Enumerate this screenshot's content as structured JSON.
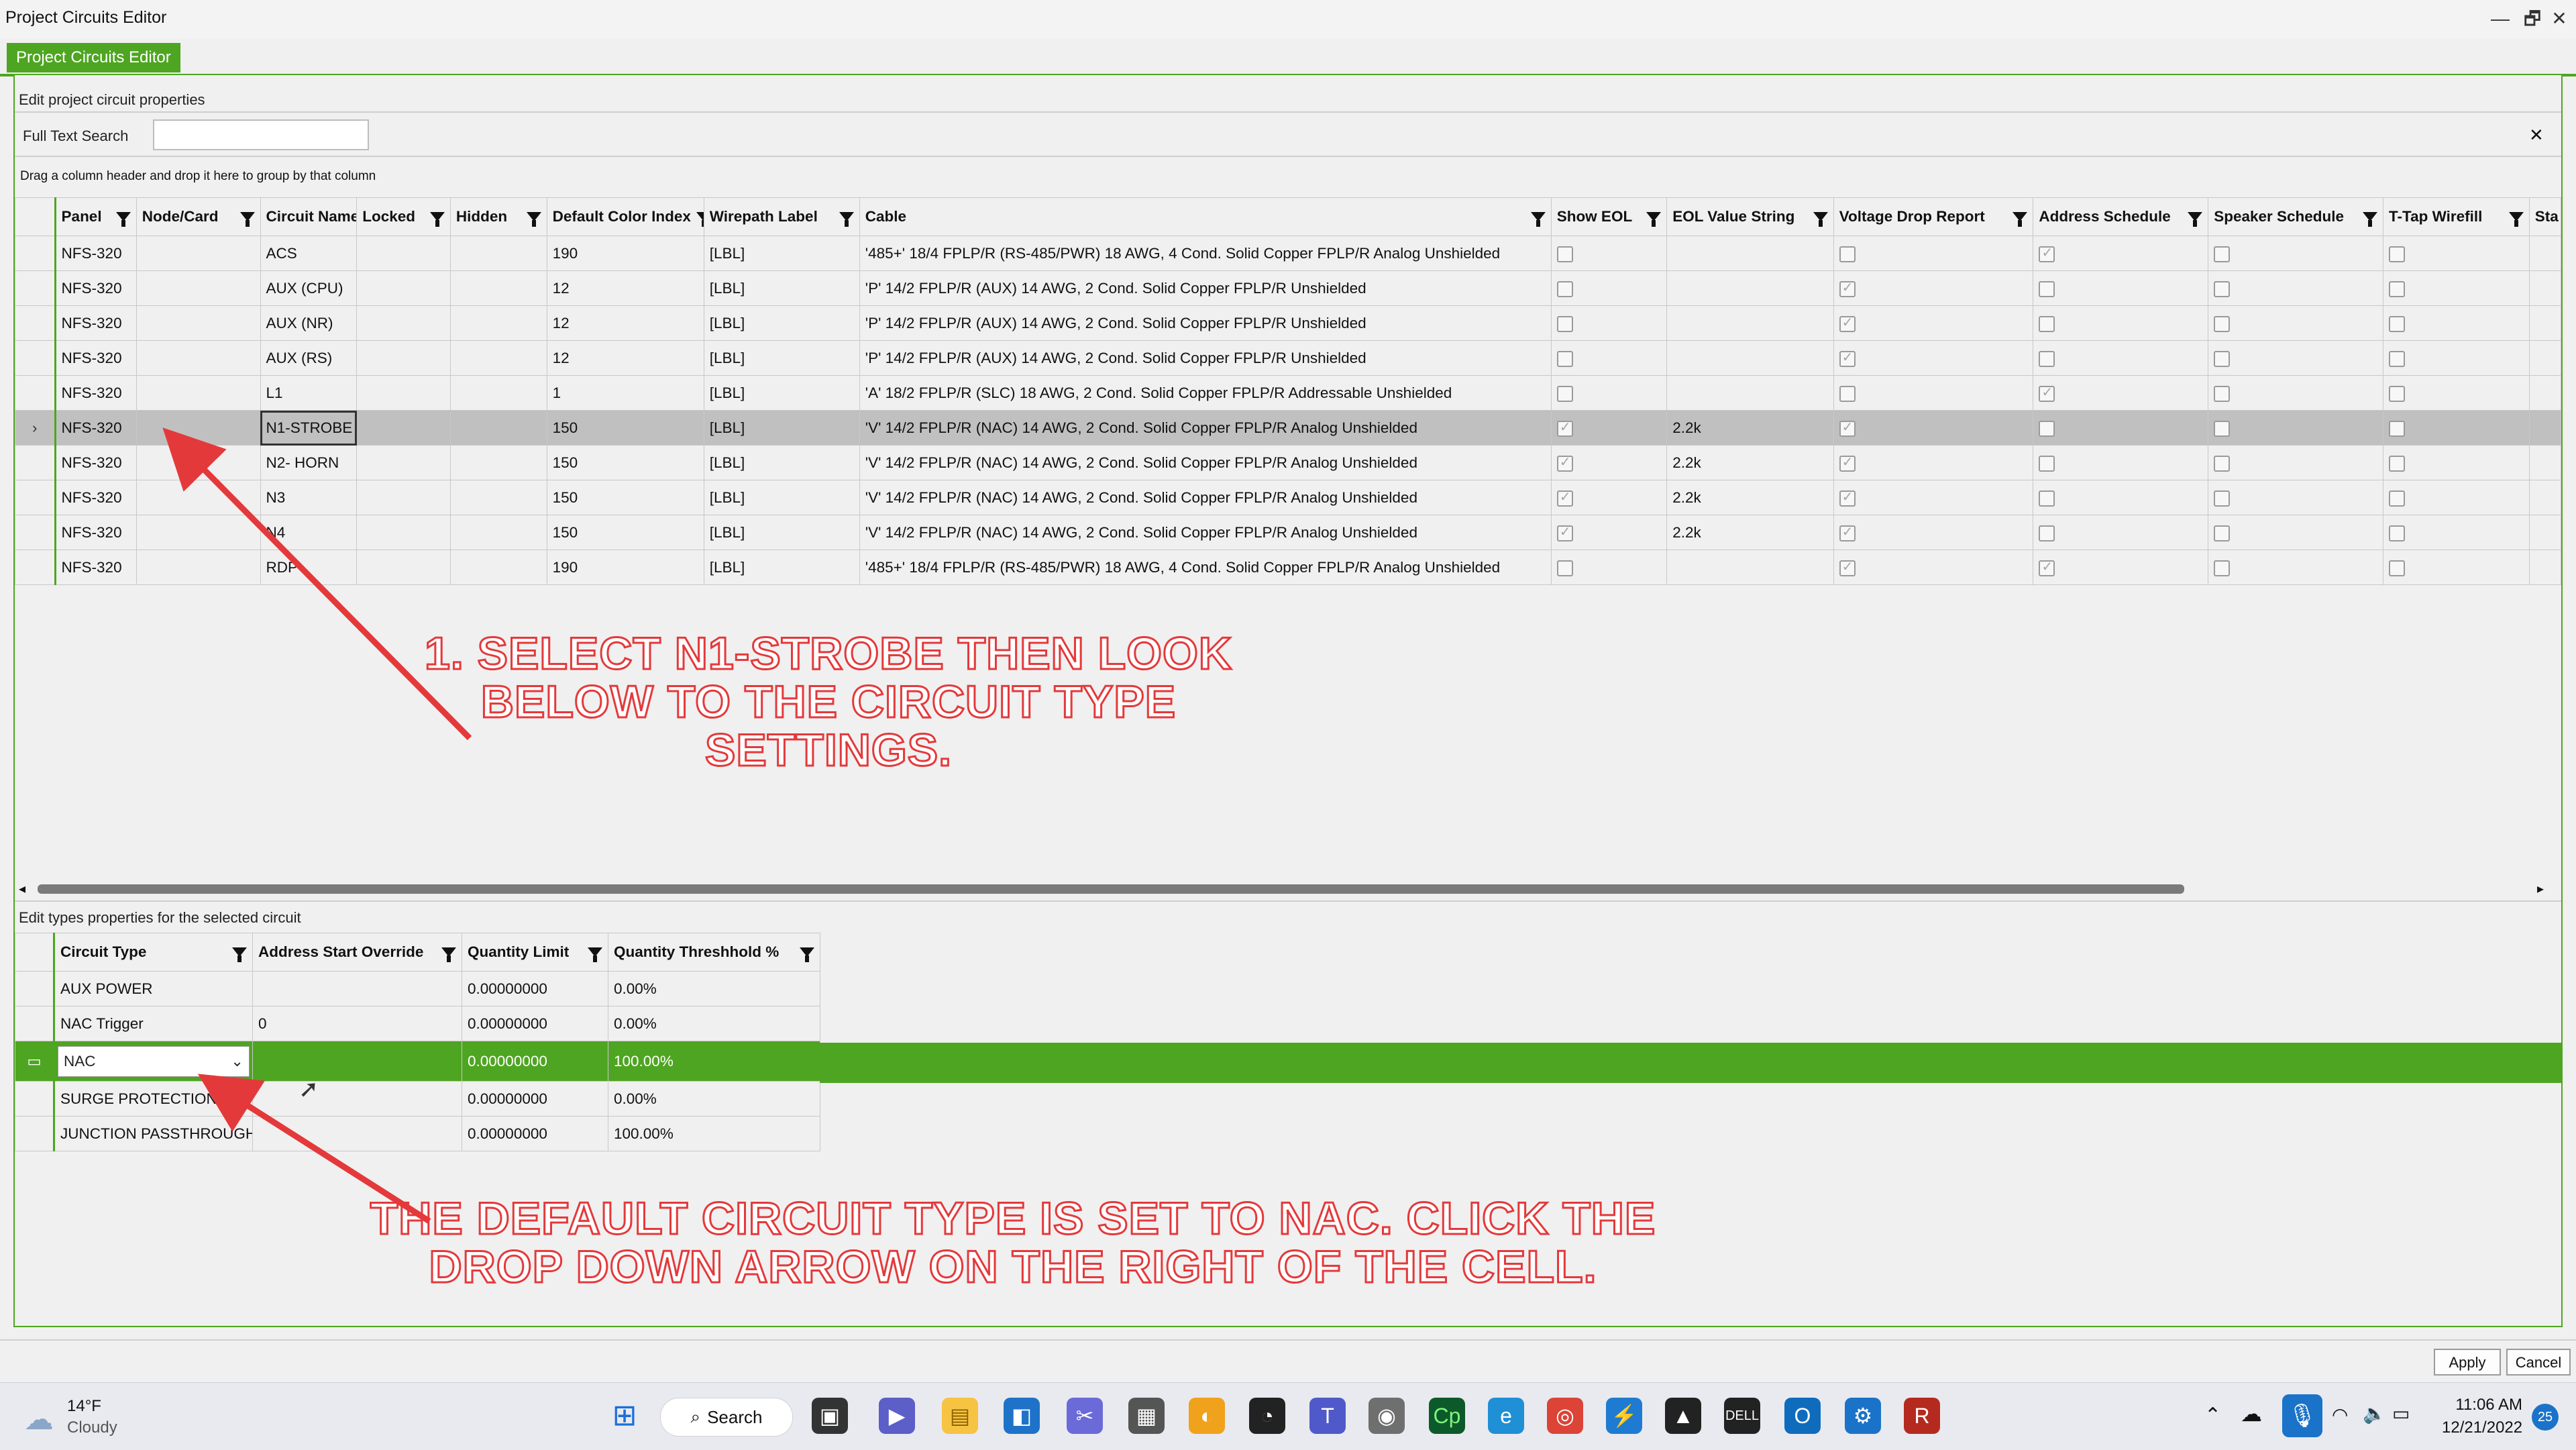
{
  "window": {
    "title": "Project Circuits Editor",
    "minimize": "—",
    "restore": "🗗",
    "close": "✕"
  },
  "tab": {
    "label": "Project Circuits Editor"
  },
  "circuits_section": {
    "title": "Edit project circuit properties",
    "search_label": "Full Text Search",
    "search_value": "",
    "clear": "✕",
    "group_hint": "Drag a column header and drop it here to group by that column",
    "columns": [
      "Panel",
      "Node/Card",
      "Circuit Name",
      "Locked",
      "Hidden",
      "Default Color Index",
      "Wirepath Label",
      "Cable",
      "Show EOL",
      "EOL Value String",
      "Voltage Drop Report",
      "Address Schedule",
      "Speaker Schedule",
      "T-Tap Wirefill",
      "Sta"
    ],
    "rows": [
      {
        "panel": "NFS-320",
        "node": "",
        "name": "ACS",
        "color": "190",
        "wirepath": "[LBL]",
        "cable": "'485+' 18/4 FPLP/R (RS-485/PWR) 18 AWG, 4 Cond. Solid Copper FPLP/R Analog Unshielded",
        "show_eol": false,
        "eol": "",
        "vdrop": false,
        "addr": true,
        "spk": false,
        "ttap": false
      },
      {
        "panel": "NFS-320",
        "node": "",
        "name": "AUX (CPU)",
        "color": "12",
        "wirepath": "[LBL]",
        "cable": "'P' 14/2 FPLP/R (AUX) 14 AWG, 2 Cond. Solid Copper FPLP/R  Unshielded",
        "show_eol": false,
        "eol": "",
        "vdrop": true,
        "addr": false,
        "spk": false,
        "ttap": false
      },
      {
        "panel": "NFS-320",
        "node": "",
        "name": "AUX (NR)",
        "color": "12",
        "wirepath": "[LBL]",
        "cable": "'P' 14/2 FPLP/R (AUX) 14 AWG, 2 Cond. Solid Copper FPLP/R  Unshielded",
        "show_eol": false,
        "eol": "",
        "vdrop": true,
        "addr": false,
        "spk": false,
        "ttap": false
      },
      {
        "panel": "NFS-320",
        "node": "",
        "name": "AUX (RS)",
        "color": "12",
        "wirepath": "[LBL]",
        "cable": "'P' 14/2 FPLP/R (AUX) 14 AWG, 2 Cond. Solid Copper FPLP/R  Unshielded",
        "show_eol": false,
        "eol": "",
        "vdrop": true,
        "addr": false,
        "spk": false,
        "ttap": false
      },
      {
        "panel": "NFS-320",
        "node": "",
        "name": "L1",
        "color": "1",
        "wirepath": "[LBL]",
        "cable": "'A' 18/2 FPLP/R (SLC) 18 AWG, 2 Cond. Solid Copper FPLP/R Addressable Unshielded",
        "show_eol": false,
        "eol": "",
        "vdrop": false,
        "addr": true,
        "spk": false,
        "ttap": false
      },
      {
        "panel": "NFS-320",
        "node": "",
        "name": "N1-STROBE",
        "color": "150",
        "wirepath": "[LBL]",
        "cable": "'V' 14/2 FPLP/R (NAC) 14 AWG, 2 Cond. Solid Copper FPLP/R Analog Unshielded",
        "show_eol": true,
        "eol": "2.2k",
        "vdrop": true,
        "addr": false,
        "spk": false,
        "ttap": false
      },
      {
        "panel": "NFS-320",
        "node": "",
        "name": "N2- HORN",
        "color": "150",
        "wirepath": "[LBL]",
        "cable": "'V' 14/2 FPLP/R (NAC) 14 AWG, 2 Cond. Solid Copper FPLP/R Analog Unshielded",
        "show_eol": true,
        "eol": "2.2k",
        "vdrop": true,
        "addr": false,
        "spk": false,
        "ttap": false
      },
      {
        "panel": "NFS-320",
        "node": "",
        "name": "N3",
        "color": "150",
        "wirepath": "[LBL]",
        "cable": "'V' 14/2 FPLP/R (NAC) 14 AWG, 2 Cond. Solid Copper FPLP/R Analog Unshielded",
        "show_eol": true,
        "eol": "2.2k",
        "vdrop": true,
        "addr": false,
        "spk": false,
        "ttap": false
      },
      {
        "panel": "NFS-320",
        "node": "",
        "name": "N4",
        "color": "150",
        "wirepath": "[LBL]",
        "cable": "'V' 14/2 FPLP/R (NAC) 14 AWG, 2 Cond. Solid Copper FPLP/R Analog Unshielded",
        "show_eol": true,
        "eol": "2.2k",
        "vdrop": true,
        "addr": false,
        "spk": false,
        "ttap": false
      },
      {
        "panel": "NFS-320",
        "node": "",
        "name": "RDP",
        "color": "190",
        "wirepath": "[LBL]",
        "cable": "'485+' 18/4 FPLP/R (RS-485/PWR) 18 AWG, 4 Cond. Solid Copper FPLP/R Analog Unshielded",
        "show_eol": false,
        "eol": "",
        "vdrop": true,
        "addr": true,
        "spk": false,
        "ttap": false
      }
    ],
    "selected_row_marker": "›"
  },
  "annotation1": {
    "lines": [
      "1. SELECT N1-STROBE THEN LOOK",
      "BELOW TO THE CIRCUIT TYPE",
      "SETTINGS."
    ]
  },
  "types_section": {
    "title": "Edit types properties for the selected circuit",
    "columns": [
      "Circuit Type",
      "Address Start Override",
      "Quantity Limit",
      "Quantity Threshhold %"
    ],
    "rows": [
      {
        "type": "AUX POWER",
        "start": "",
        "limit": "0.00000000",
        "threshold": "0.00%"
      },
      {
        "type": "NAC Trigger",
        "start": "0",
        "limit": "0.00000000",
        "threshold": "0.00%"
      },
      {
        "type": "NAC",
        "start": "",
        "limit": "0.00000000",
        "threshold": "100.00%"
      },
      {
        "type": "SURGE PROTECTION",
        "start": "",
        "limit": "0.00000000",
        "threshold": "0.00%"
      },
      {
        "type": "JUNCTION PASSTHROUGH",
        "start": "",
        "limit": "0.00000000",
        "threshold": "100.00%"
      }
    ],
    "dropdown_arrow": "⌄"
  },
  "annotation2": {
    "lines": [
      "THE DEFAULT CIRCUIT TYPE IS SET TO NAC. CLICK THE",
      "DROP DOWN ARROW ON THE RIGHT OF THE CELL."
    ]
  },
  "buttons": {
    "apply": "Apply",
    "cancel": "Cancel"
  },
  "taskbar": {
    "weather_temp": "14°F",
    "weather_desc": "Cloudy",
    "search": "Search",
    "time": "11:06 AM",
    "date": "12/21/2022",
    "notification_count": "25",
    "icons": [
      "start-icon",
      "search-icon",
      "task-view-icon",
      "camera-meet-icon",
      "file-explorer-icon",
      "app-icon",
      "snip-icon",
      "calculator-icon",
      "edge-beta-icon",
      "speedometer-icon",
      "teams-icon",
      "camera-icon",
      "captivate-icon",
      "edge-icon",
      "chrome-icon",
      "terminal-icon",
      "ada-icon",
      "dell-icon",
      "outlook-icon",
      "settings-icon",
      "revit-icon"
    ]
  },
  "colors": {
    "accent": "#4ea521",
    "annotation": "#e4393b",
    "selected_row": "#c0c0c0"
  }
}
